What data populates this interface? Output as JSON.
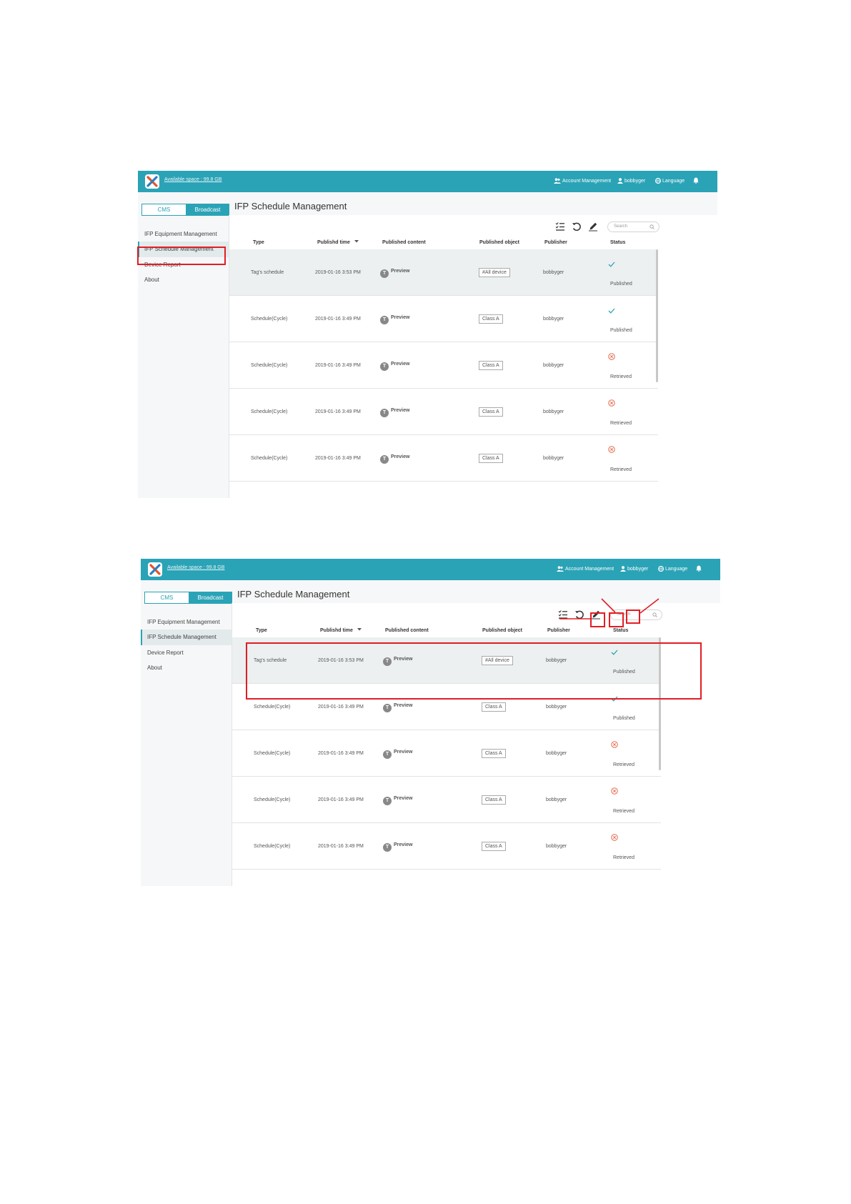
{
  "app": {
    "available_space": "Available space : 99.8 GB",
    "nav": {
      "account_management": "Account Management",
      "user": "bobbyger",
      "language": "Language"
    },
    "tabs": {
      "cms": "CMS",
      "broadcast": "Broadcast"
    },
    "sidebar": [
      "IFP Equipment Management",
      "IFP Schedule Management",
      "Device Report",
      "About"
    ],
    "page_title": "IFP Schedule Management",
    "search_placeholder": "Search",
    "columns": {
      "type": "Type",
      "publish_time": "Publishd time",
      "published_content": "Published content",
      "published_object": "Published object",
      "publisher": "Publisher",
      "status": "Status"
    },
    "rows": [
      {
        "type": "Tag's schedule",
        "time": "2019-01-16 3:53 PM",
        "content": "Preview",
        "object": "#All device",
        "publisher": "bobbyger",
        "status": "Published",
        "state": "ok"
      },
      {
        "type": "Schedule(Cycle)",
        "time": "2019-01-16 3:49 PM",
        "content": "Preview",
        "object": "Class A",
        "publisher": "bobbyger",
        "status": "Published",
        "state": "ok"
      },
      {
        "type": "Schedule(Cycle)",
        "time": "2019-01-16 3:49 PM",
        "content": "Preview",
        "object": "Class A",
        "publisher": "bobbyger",
        "status": "Retrieved",
        "state": "err"
      },
      {
        "type": "Schedule(Cycle)",
        "time": "2019-01-16 3:49 PM",
        "content": "Preview",
        "object": "Class A",
        "publisher": "bobbyger",
        "status": "Retrieved",
        "state": "err"
      },
      {
        "type": "Schedule(Cycle)",
        "time": "2019-01-16 3:49 PM",
        "content": "Preview",
        "object": "Class A",
        "publisher": "bobbyger",
        "status": "Retrieved",
        "state": "err"
      }
    ],
    "preview_glyph": "T"
  },
  "colors": {
    "accent": "#2ba3b6",
    "highlight_row": "#edf0f0",
    "annotation_red": "#e21d24",
    "ok_check": "#2ba3b6",
    "err_icon": "#e06a4a"
  }
}
